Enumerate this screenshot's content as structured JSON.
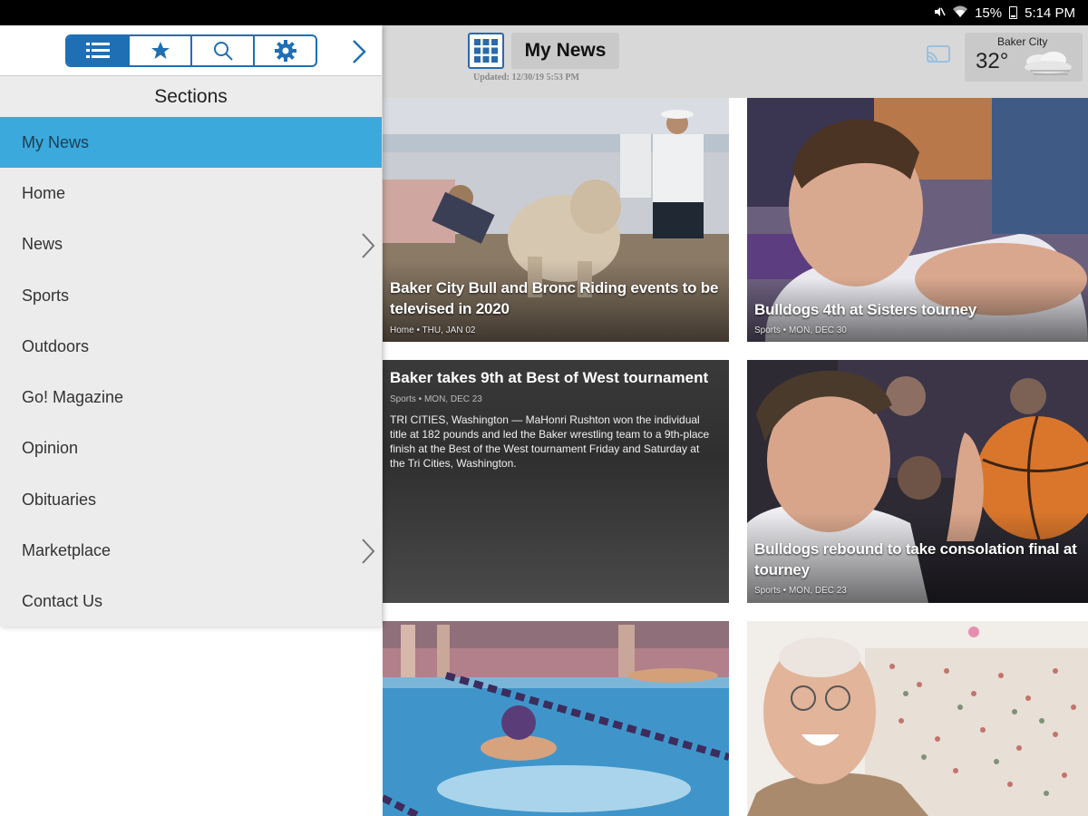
{
  "status_bar": {
    "battery": "15%",
    "time": "5:14 PM"
  },
  "header": {
    "title": "My News",
    "updated": "Updated: 12/30/19 5:53 PM",
    "weather": {
      "city": "Baker City",
      "temp": "32°"
    }
  },
  "drawer": {
    "sections_title": "Sections",
    "toolbar": [
      "list-icon",
      "star-icon",
      "search-icon",
      "gear-icon"
    ],
    "items": [
      {
        "label": "My News",
        "active": true,
        "has_submenu": false
      },
      {
        "label": "Home",
        "has_submenu": false
      },
      {
        "label": "News",
        "has_submenu": true
      },
      {
        "label": "Sports",
        "has_submenu": false
      },
      {
        "label": "Outdoors",
        "has_submenu": false
      },
      {
        "label": "Go! Magazine",
        "has_submenu": false
      },
      {
        "label": "Opinion",
        "has_submenu": false
      },
      {
        "label": "Obituaries",
        "has_submenu": false
      },
      {
        "label": "Marketplace",
        "has_submenu": true
      },
      {
        "label": "Contact Us",
        "has_submenu": false
      }
    ]
  },
  "stories": [
    {
      "headline": "Baker City Bull and Bronc Riding events to be televised in 2020",
      "meta": "Home • THU, JAN 02"
    },
    {
      "headline": "Bulldogs 4th at Sisters tourney",
      "meta": "Sports • MON, DEC 30"
    },
    {
      "headline": "Baker takes 9th at Best of West tournament",
      "meta": "Sports • MON, DEC 23",
      "summary": "TRI CITIES, Washington — MaHonri Rushton won the individual title at 182 pounds and led the Baker wrestling team to a 9th-place finish at the Best of the West tournament Friday and Saturday at the Tri Cities, Washington."
    },
    {
      "headline": "Bulldogs rebound to take consolation final at tourney",
      "meta": "Sports • MON, DEC 23"
    }
  ],
  "colors": {
    "accent": "#1f6fb5",
    "active_item": "#3ba9dc",
    "header_bg": "#d8d8d8"
  }
}
